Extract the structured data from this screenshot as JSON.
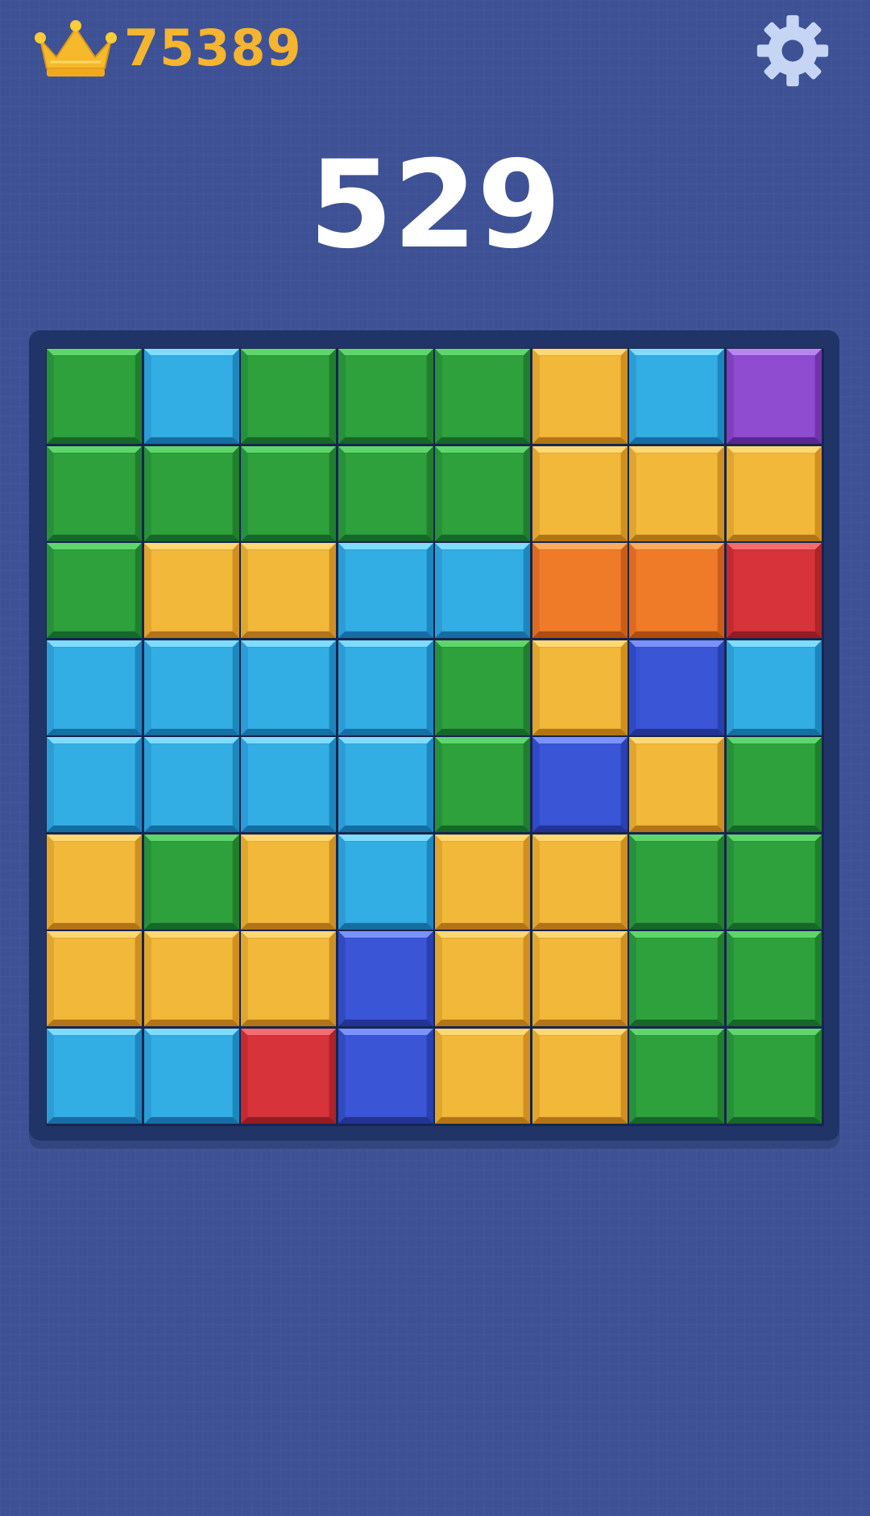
{
  "header": {
    "best_score": "75389",
    "crown_icon": "crown-icon",
    "settings_icon": "gear-icon"
  },
  "score": {
    "current": "529"
  },
  "palette": {
    "background": "#3d5194",
    "best_score_color": "#f5b52e",
    "green": "#2ea13c",
    "cyan": "#33aee4",
    "yellow": "#f2b83a",
    "purple": "#8f4cd0",
    "orange": "#ef7b28",
    "red": "#d6343a",
    "blue": "#3a55d6"
  },
  "board": {
    "rows": 8,
    "cols": 8,
    "cells": [
      [
        "green",
        "cyan",
        "green",
        "green",
        "green",
        "yellow",
        "cyan",
        "purple"
      ],
      [
        "green",
        "green",
        "green",
        "green",
        "green",
        "yellow",
        "yellow",
        "yellow"
      ],
      [
        "green",
        "yellow",
        "yellow",
        "cyan",
        "cyan",
        "orange",
        "orange",
        "red"
      ],
      [
        "cyan",
        "cyan",
        "cyan",
        "cyan",
        "green",
        "yellow",
        "blue",
        "cyan"
      ],
      [
        "cyan",
        "cyan",
        "cyan",
        "cyan",
        "green",
        "blue",
        "yellow",
        "green"
      ],
      [
        "yellow",
        "green",
        "yellow",
        "cyan",
        "yellow",
        "yellow",
        "green",
        "green"
      ],
      [
        "yellow",
        "yellow",
        "yellow",
        "blue",
        "yellow",
        "yellow",
        "green",
        "green"
      ],
      [
        "cyan",
        "cyan",
        "red",
        "blue",
        "yellow",
        "yellow",
        "green",
        "green"
      ]
    ]
  }
}
